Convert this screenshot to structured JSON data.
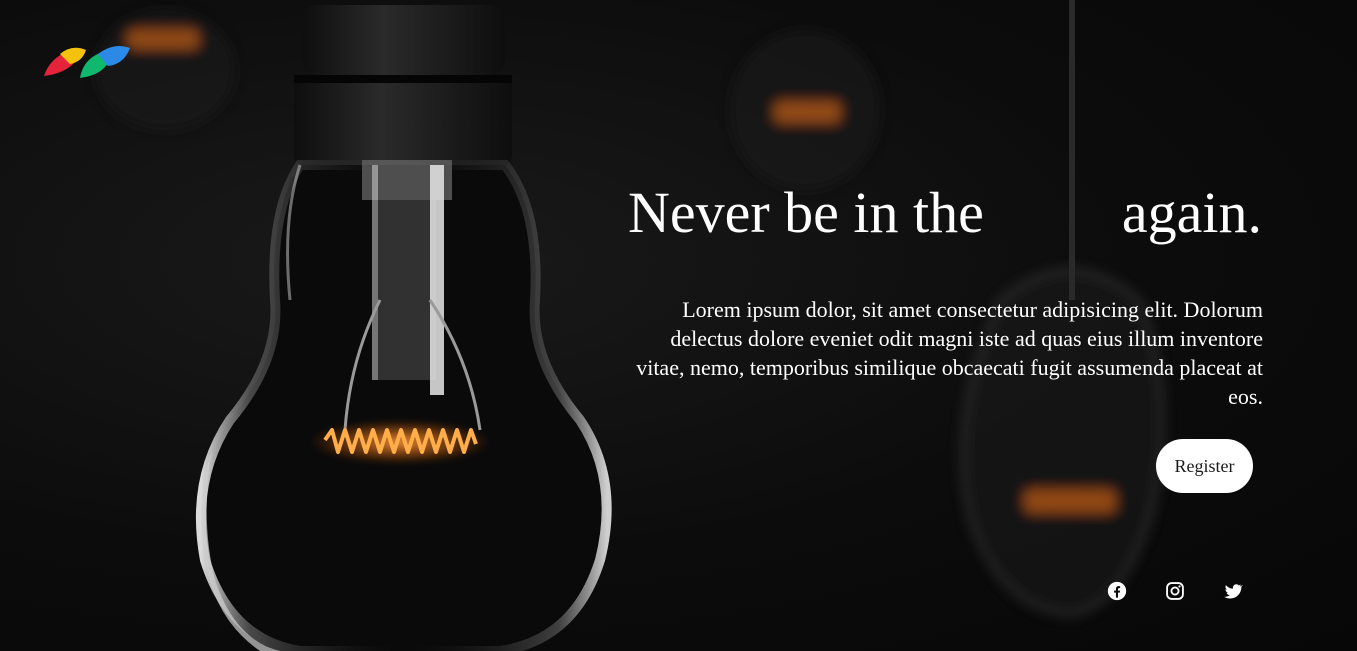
{
  "brand": {
    "logo_icon": "colorful-leaf-logo-icon",
    "colors": [
      "#e5243b",
      "#f4c20d",
      "#0fb86c",
      "#2b8ae8"
    ]
  },
  "hero": {
    "headline_start": "Never be in the",
    "headline_end": "again.",
    "paragraph": "Lorem ipsum dolor, sit amet consectetur adipisicing elit. Dolorum delectus dolore eveniet odit magni iste ad quas eius illum inventore vitae, nemo, temporibus similique obcaecati fugit assumenda placeat at eos.",
    "register_label": "Register",
    "background_icon": "light-bulb-illustration",
    "accent_color": "#f07a1a"
  },
  "socials": [
    {
      "name": "facebook",
      "icon": "facebook-icon"
    },
    {
      "name": "instagram",
      "icon": "instagram-icon"
    },
    {
      "name": "twitter",
      "icon": "twitter-icon"
    }
  ]
}
